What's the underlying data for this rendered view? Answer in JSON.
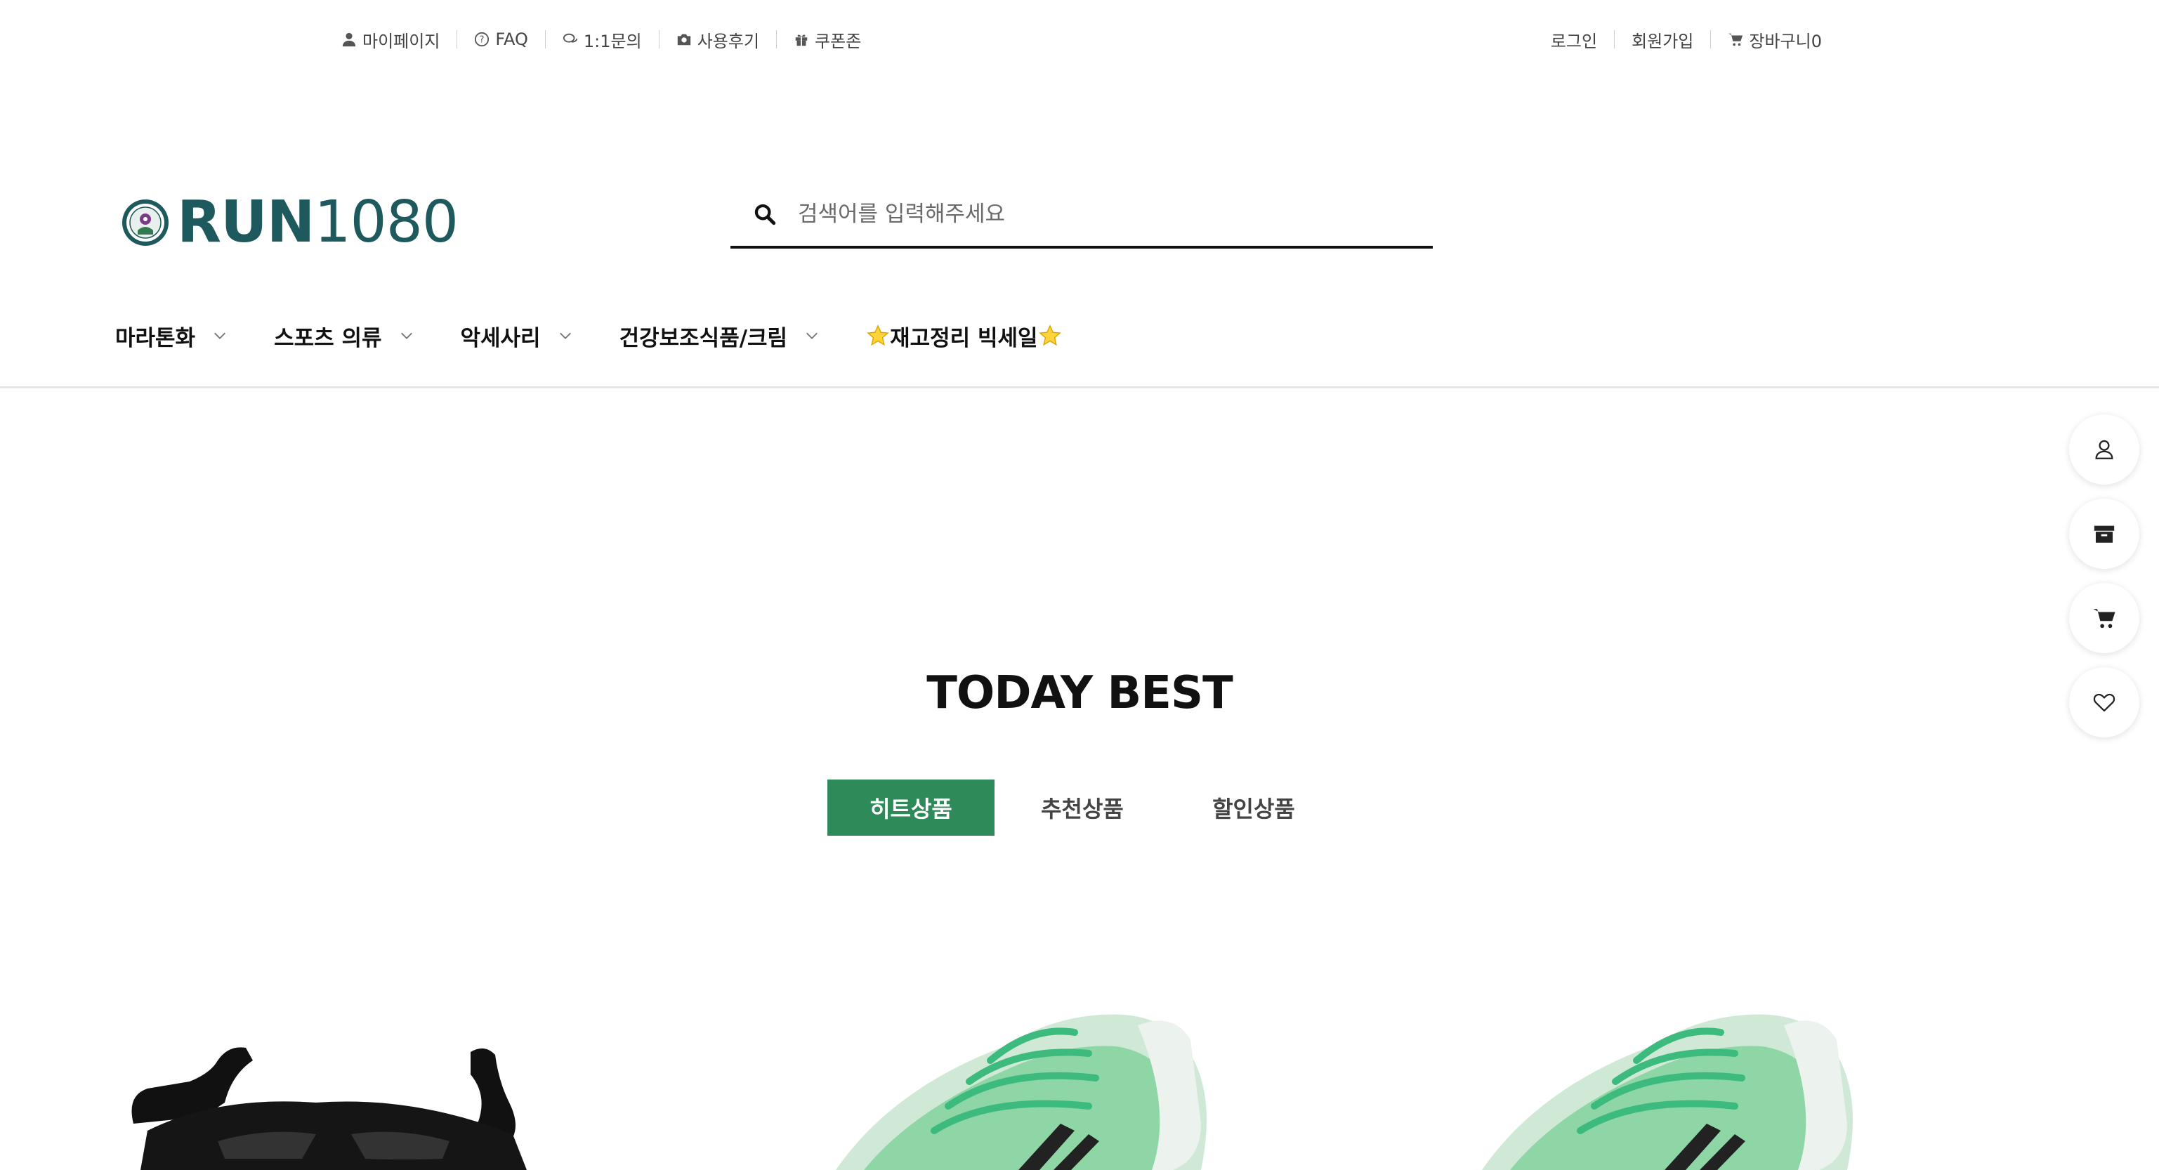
{
  "util_left": [
    {
      "label": "마이페이지",
      "icon": "user-icon"
    },
    {
      "label": "FAQ",
      "icon": "question-circle-icon"
    },
    {
      "label": "1:1문의",
      "icon": "chat-bubbles-icon"
    },
    {
      "label": "사용후기",
      "icon": "camera-icon"
    },
    {
      "label": "쿠폰존",
      "icon": "gift-icon"
    }
  ],
  "util_right": [
    {
      "label": "로그인"
    },
    {
      "label": "회원가입"
    },
    {
      "label": "장바구니",
      "icon": "cart-icon",
      "count": "0"
    }
  ],
  "logo": {
    "bold": "RUN",
    "light": "1080"
  },
  "search": {
    "placeholder": "검색어를 입력해주세요",
    "value": ""
  },
  "nav": [
    {
      "label": "마라톤화",
      "has_dropdown": true
    },
    {
      "label": "스포츠 의류",
      "has_dropdown": true
    },
    {
      "label": "악세사리",
      "has_dropdown": true
    },
    {
      "label": "건강보조식품/크림",
      "has_dropdown": true
    },
    {
      "label": "재고정리 빅세일",
      "has_dropdown": false,
      "decoration": "star-icon"
    }
  ],
  "quick_menu": [
    {
      "icon": "user-outline-icon"
    },
    {
      "icon": "archive-box-icon"
    },
    {
      "icon": "cart-icon"
    },
    {
      "icon": "heart-outline-icon"
    }
  ],
  "section": {
    "title": "TODAY BEST"
  },
  "tabs": [
    {
      "label": "히트상품",
      "active": true
    },
    {
      "label": "추천상품",
      "active": false
    },
    {
      "label": "할인상품",
      "active": false
    }
  ],
  "colors": {
    "brand": "#1e5a5d",
    "tab_active": "#2f8a5a",
    "shoe_green": "#7fd4a0"
  }
}
